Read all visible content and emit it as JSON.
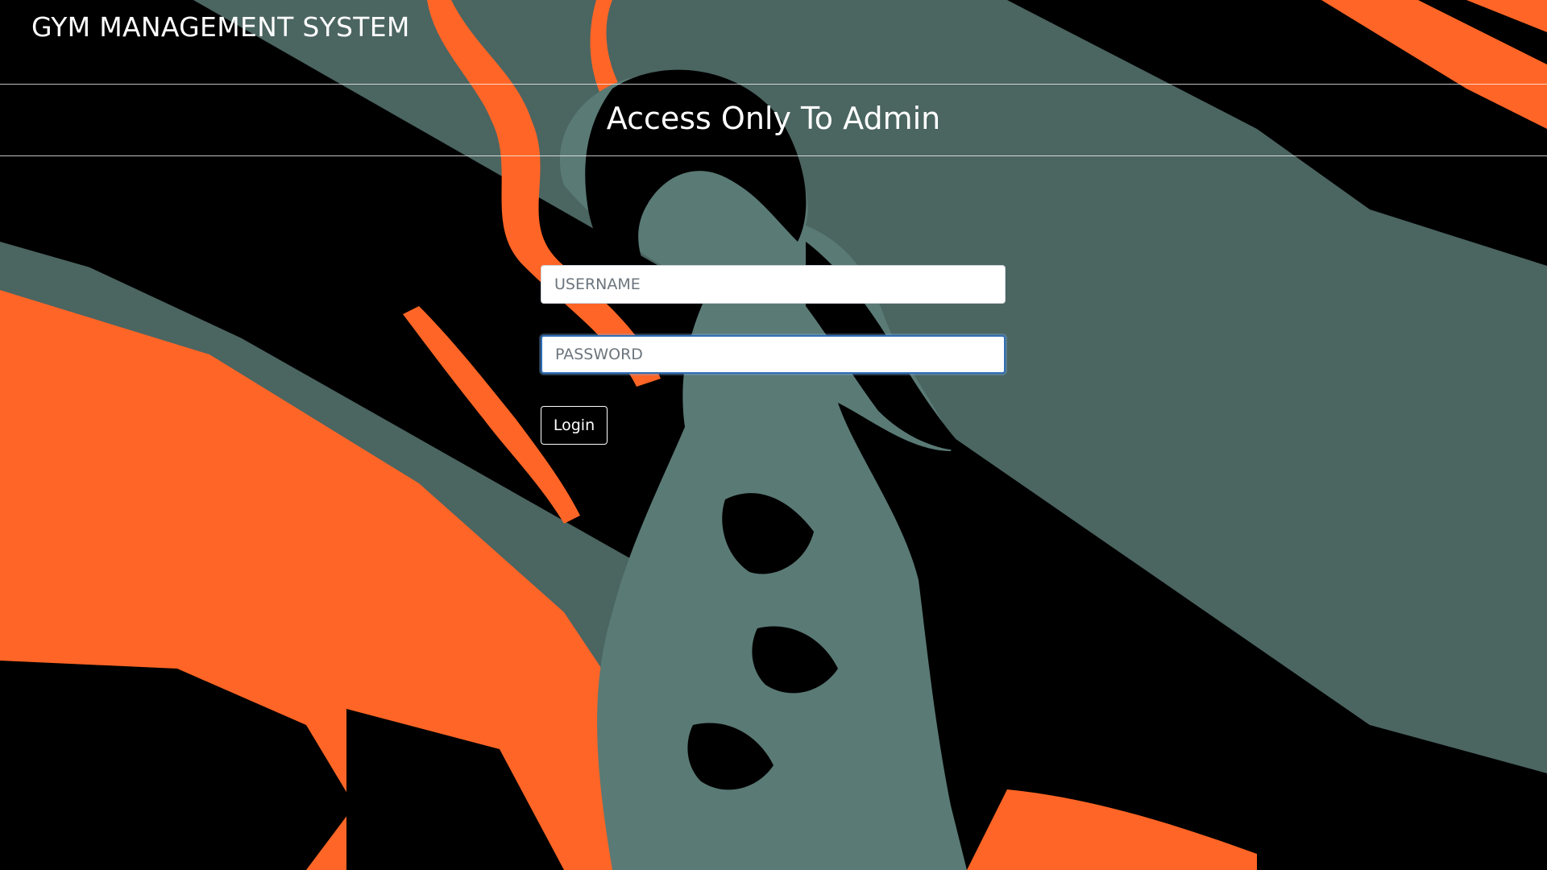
{
  "header": {
    "brand": "GYM MANAGEMENT SYSTEM"
  },
  "banner": {
    "heading": "Access Only To Admin"
  },
  "form": {
    "username": {
      "value": "",
      "placeholder": "USERNAME"
    },
    "password": {
      "value": "",
      "placeholder": "PASSWORD",
      "focused": true
    },
    "login_label": "Login"
  },
  "theme": {
    "background": "#4b6561",
    "accent_orange": "#ff6526",
    "dark": "#000000",
    "focus_ring": "#2f6fb5"
  }
}
